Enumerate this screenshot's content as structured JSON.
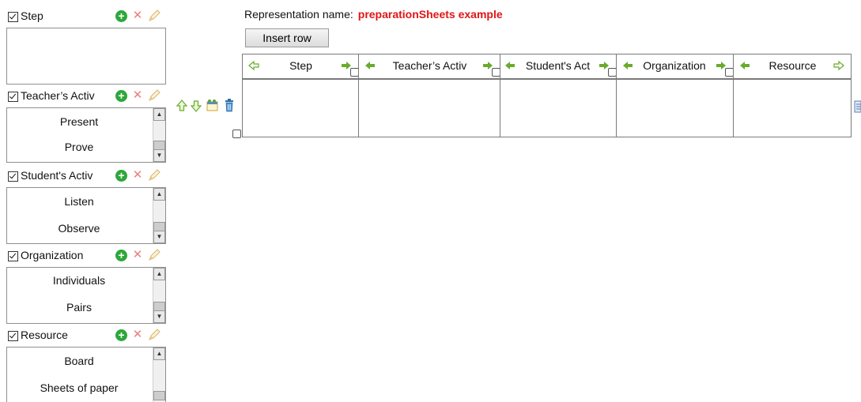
{
  "representation": {
    "label": "Representation name:",
    "value": "preparationSheets example"
  },
  "toolbar": {
    "insert_row_label": "Insert row"
  },
  "categories": [
    {
      "label": "Step",
      "items": []
    },
    {
      "label": "Teacher’s Activ",
      "items": [
        "Present",
        "Prove"
      ]
    },
    {
      "label": "Student's Activ",
      "items": [
        "Listen",
        "Observe"
      ]
    },
    {
      "label": "Organization",
      "items": [
        "Individuals",
        "Pairs"
      ]
    },
    {
      "label": "Resource",
      "items": [
        "Board",
        "Sheets of paper"
      ]
    }
  ],
  "icons": {
    "add": "+",
    "delete": "✕"
  },
  "columns": [
    {
      "label": "Step"
    },
    {
      "label": "Teacher’s Activ"
    },
    {
      "label": "Student's Act"
    },
    {
      "label": "Organization"
    },
    {
      "label": "Resource"
    }
  ],
  "colors": {
    "accent_green": "#6aab2e",
    "title_red": "#e01515",
    "add_green": "#2da73a"
  }
}
